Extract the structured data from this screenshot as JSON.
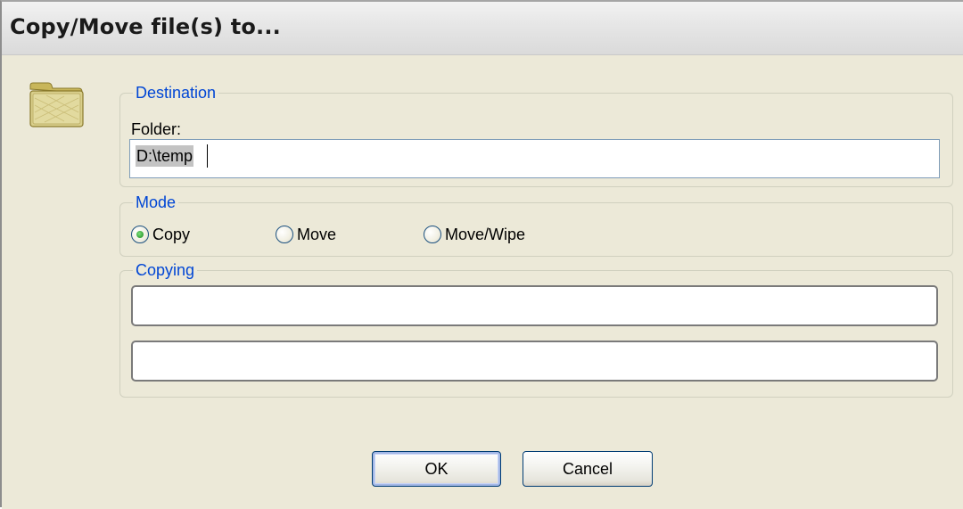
{
  "dialog": {
    "title": "Copy/Move file(s) to..."
  },
  "icon": {
    "name": "folder-icon",
    "color": "#d6c97a"
  },
  "destination": {
    "legend": "Destination",
    "folder_label": "Folder:",
    "folder_value": "D:\\temp"
  },
  "mode": {
    "legend": "Mode",
    "options": [
      {
        "label": "Copy",
        "selected": true
      },
      {
        "label": "Move",
        "selected": false
      },
      {
        "label": "Move/Wipe",
        "selected": false
      }
    ]
  },
  "copying": {
    "legend": "Copying",
    "line1": "",
    "line2": ""
  },
  "buttons": {
    "ok": "OK",
    "cancel": "Cancel"
  },
  "colors": {
    "legend_text": "#0046d5",
    "dialog_bg": "#ece9d8",
    "selected_radio": "#21a121"
  }
}
